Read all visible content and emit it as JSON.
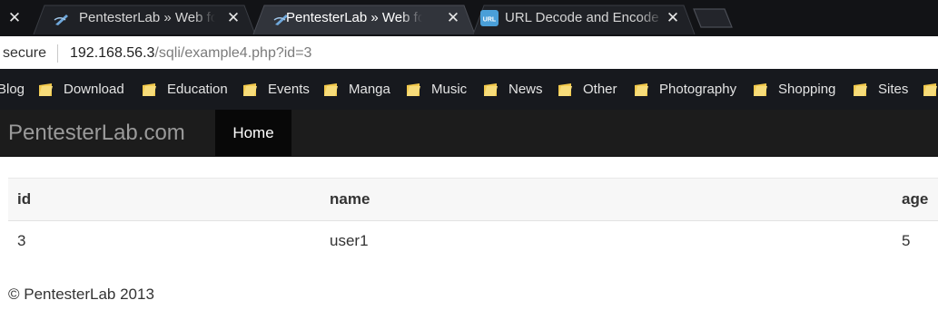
{
  "tabs": [
    {
      "title": "PentesterLab » Web for Pentester",
      "favicon": "pentesterlab-favicon"
    },
    {
      "title": "PentesterLab » Web for Pentester",
      "favicon": "pentesterlab-favicon",
      "active": true
    },
    {
      "title": "URL Decode and Encode - Online",
      "favicon": "url-favicon",
      "favicon_text": "URL"
    }
  ],
  "tab_close_glyph": "✕",
  "address": {
    "security": "secure",
    "url_host": "192.168.56.3",
    "url_path": "/sqli/example4.php?id=3"
  },
  "bookmarks": [
    "Blog",
    "Download",
    "Education",
    "Events",
    "Manga",
    "Music",
    "News",
    "Other",
    "Photography",
    "Shopping",
    "Sites"
  ],
  "site": {
    "brand": "PentesterLab.com",
    "nav": [
      "Home"
    ]
  },
  "table": {
    "headers": [
      "id",
      "name",
      "age"
    ],
    "rows": [
      [
        "3",
        "user1",
        "5"
      ]
    ]
  },
  "footer": "© PentesterLab 2013",
  "colors": {
    "tabstrip": "#121316",
    "bookmarks_bg": "#17191e",
    "folder": "#f2c94c",
    "navbar": "#1c1c1c"
  }
}
